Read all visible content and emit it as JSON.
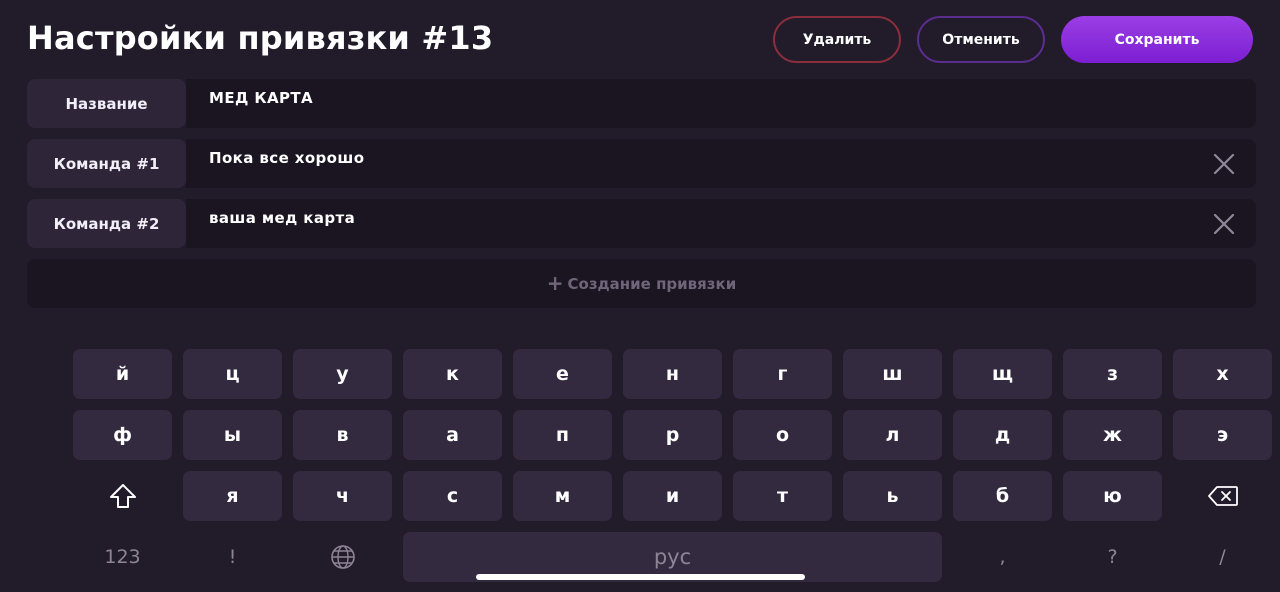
{
  "header": {
    "title": "Настройки привязки #13",
    "delete_label": "Удалить",
    "cancel_label": "Отменить",
    "save_label": "Сохранить"
  },
  "rows": [
    {
      "label": "Название",
      "value": "МЕД КАРТА",
      "clearable": false
    },
    {
      "label": "Команда #1",
      "value": "Пока все хорошо",
      "clearable": true
    },
    {
      "label": "Команда #2",
      "value": "ваша мед карта",
      "clearable": true
    }
  ],
  "add_binding": {
    "plus": "+",
    "label": "Создание привязки"
  },
  "keyboard": {
    "row1": [
      "й",
      "ц",
      "у",
      "к",
      "е",
      "н",
      "г",
      "ш",
      "щ",
      "з",
      "х"
    ],
    "row2": [
      "ф",
      "ы",
      "в",
      "а",
      "п",
      "р",
      "о",
      "л",
      "д",
      "ж",
      "э"
    ],
    "row3": [
      "я",
      "ч",
      "с",
      "м",
      "и",
      "т",
      "ь",
      "б",
      "ю"
    ],
    "numbers_label": "123",
    "exclaim_label": "!",
    "space_label": "рус",
    "comma_label": ",",
    "question_label": "?",
    "slash_label": "/",
    "icons": {
      "shift": "shift-icon",
      "backspace": "backspace-icon",
      "globe": "globe-icon"
    }
  },
  "colors": {
    "background": "#221b2a",
    "delete_border": "#8a2d3c",
    "cancel_border": "#5a2d8e",
    "save_accent": "#8a2fe0",
    "key_background": "#342a40"
  }
}
